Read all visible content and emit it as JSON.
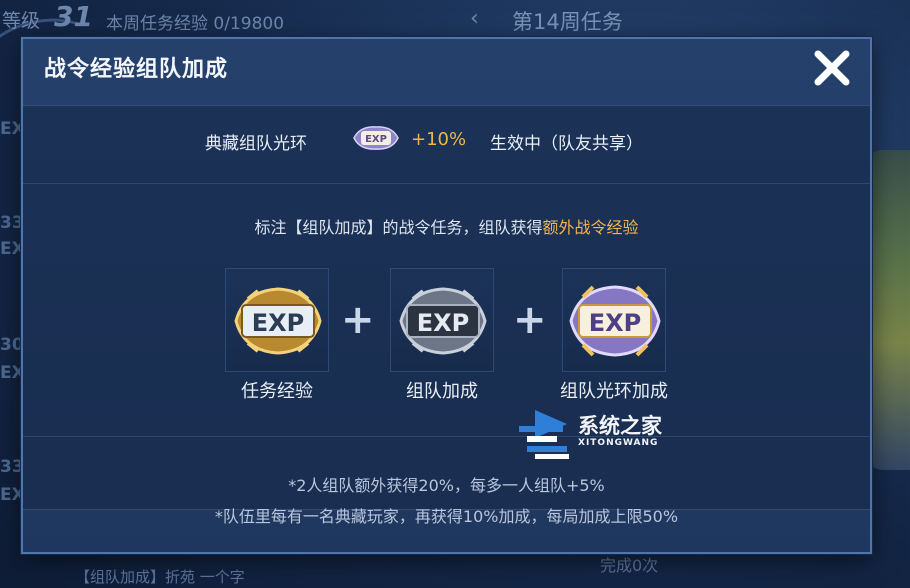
{
  "background": {
    "level_label": "等级",
    "level_value": "31",
    "weekly_exp": "本周任务经验 0/19800",
    "week_title": "第14周任务",
    "side_items": [
      "EX",
      "33",
      "EX",
      "30",
      "EX",
      "33",
      "EX"
    ],
    "bottom_text": "【组队加成】折苑 一个字",
    "done_text": "完成0次"
  },
  "dialog": {
    "title": "战令经验组队加成",
    "aura": {
      "label": "典藏组队光环",
      "icon_text": "EXP",
      "bonus": "+10%",
      "status": "生效中（队友共享）"
    },
    "description_prefix": "标注【组队加成】的战令任务，组队获得",
    "description_highlight": "额外战令经验",
    "exp_items": [
      {
        "label": "任务经验",
        "icon_text": "EXP",
        "icon": "gold-exp-badge-icon"
      },
      {
        "label": "组队加成",
        "icon_text": "EXP",
        "icon": "silver-exp-badge-icon"
      },
      {
        "label": "组队光环加成",
        "icon_text": "EXP",
        "icon": "legendary-exp-badge-icon"
      }
    ],
    "plus_sign": "+",
    "notes": [
      "*2人组队额外获得20%，每多一人组队+5%",
      "*队伍里每有一名典藏玩家，再获得10%加成，每局加成上限50%"
    ]
  },
  "watermark": {
    "title": "系统之家",
    "subtitle": "XITONGWANG"
  },
  "colors": {
    "accent_gold": "#f2b54a",
    "dialog_bg": "#22395f",
    "dialog_border": "#4f76aa"
  }
}
